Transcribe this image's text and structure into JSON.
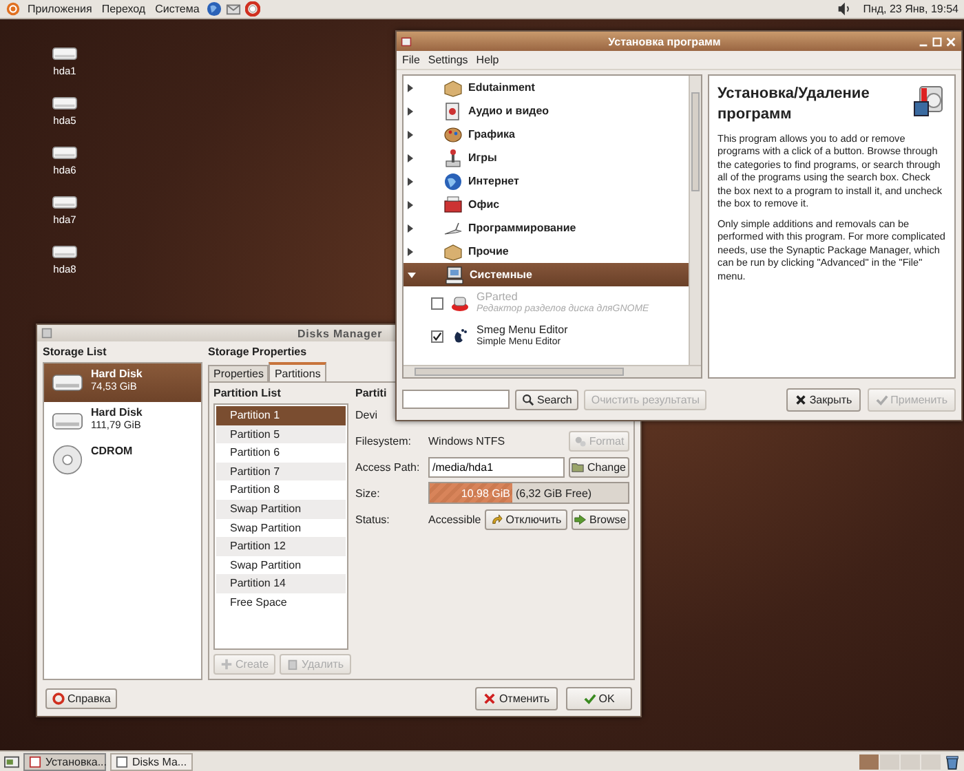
{
  "top_panel": {
    "menus": [
      "Приложения",
      "Переход",
      "Система"
    ],
    "clock": "Пнд, 23 Янв, 19:54"
  },
  "desktop_icons": [
    "hda1",
    "hda5",
    "hda6",
    "hda7",
    "hda8"
  ],
  "installer": {
    "title": "Установка программ",
    "menu": [
      "File",
      "Settings",
      "Help"
    ],
    "categories": [
      {
        "label": "Edutainment",
        "expanded": false,
        "selected": false
      },
      {
        "label": "Аудио и видео",
        "expanded": false,
        "selected": false
      },
      {
        "label": "Графика",
        "expanded": false,
        "selected": false
      },
      {
        "label": "Игры",
        "expanded": false,
        "selected": false
      },
      {
        "label": "Интернет",
        "expanded": false,
        "selected": false
      },
      {
        "label": "Офис",
        "expanded": false,
        "selected": false
      },
      {
        "label": "Программирование",
        "expanded": false,
        "selected": false
      },
      {
        "label": "Прочие",
        "expanded": false,
        "selected": false
      },
      {
        "label": "Системные",
        "expanded": true,
        "selected": true,
        "children": [
          {
            "name": "GParted",
            "description": "Редактор разделов диска дляGNOME",
            "checked": false,
            "disabled": true
          },
          {
            "name": "Smeg Menu Editor",
            "description": "Simple Menu Editor",
            "checked": true,
            "disabled": false
          }
        ]
      }
    ],
    "search_button": "Search",
    "clear_button": {
      "label": "Очистить результаты",
      "disabled": true
    },
    "info": {
      "heading": "Установка/Удаление программ",
      "paragraphs": [
        "This program allows you to add or remove programs with a click of a button. Browse through the categories to find programs, or search through all of the programs using the search box. Check the box next to a program to install it, and uncheck the box to remove it.",
        "Only simple additions and removals can be performed with this program. For more complicated needs, use the Synaptic Package Manager, which can be run by clicking \"Advanced\" in the \"File\" menu."
      ]
    },
    "buttons": [
      {
        "label": "Закрыть",
        "disabled": false
      },
      {
        "label": "Применить",
        "disabled": true
      }
    ]
  },
  "disks_manager": {
    "title": "Disks Manager",
    "storage_heading": "Storage List",
    "storage": [
      {
        "kind": "hdd",
        "name": "Hard Disk",
        "size": "74,53 GiB",
        "selected": true
      },
      {
        "kind": "hdd",
        "name": "Hard Disk",
        "size": "111,79 GiB",
        "selected": false
      },
      {
        "kind": "cdrom",
        "name": "CDROM",
        "selected": false
      }
    ],
    "properties_heading": "Storage Properties",
    "tabs": [
      {
        "label": "Properties",
        "selected": false
      },
      {
        "label": "Partitions",
        "selected": true
      }
    ],
    "partition_list_heading": "Partition List",
    "partitions": [
      {
        "label": "Partition 1",
        "selected": true
      },
      {
        "label": "Partition 5",
        "selected": false
      },
      {
        "label": "Partition 6",
        "selected": false
      },
      {
        "label": "Partition 7",
        "selected": false
      },
      {
        "label": "Partition 8",
        "selected": false
      },
      {
        "label": "Swap Partition",
        "selected": false
      },
      {
        "label": "Swap Partition",
        "selected": false
      },
      {
        "label": "Partition 12",
        "selected": false
      },
      {
        "label": "Swap Partition",
        "selected": false
      },
      {
        "label": "Partition 14",
        "selected": false
      },
      {
        "label": "Free Space",
        "selected": false
      }
    ],
    "partition_buttons": [
      {
        "label": "Create",
        "disabled": true
      },
      {
        "label": "Удалить",
        "disabled": true
      }
    ],
    "details_heading": "Partiti",
    "details": {
      "device_label": "Devi",
      "filesystem_label": "Filesystem:",
      "filesystem": "Windows NTFS",
      "format_button": {
        "label": "Format",
        "disabled": true
      },
      "access_label": "Access Path:",
      "access_path": "/media/hda1",
      "change_button": "Change",
      "size_label": "Size:",
      "size_used": "10.98 GiB",
      "size_free": "(6,32 GiB Free)",
      "size_bar": {
        "level": 0.42
      },
      "status_label": "Status:",
      "status": "Accessible",
      "unmount_button": "Отключить",
      "browse_button": "Browse"
    },
    "help_button": "Справка",
    "buttons": [
      "Отменить",
      "OK"
    ]
  },
  "taskbar": {
    "tasks": [
      {
        "label": "Установка...",
        "selected": true
      },
      {
        "label": "Disks Ma...",
        "selected": false
      }
    ],
    "workspaces": [
      {
        "selected": true
      },
      {
        "selected": false
      },
      {
        "selected": false
      },
      {
        "selected": false
      }
    ]
  }
}
